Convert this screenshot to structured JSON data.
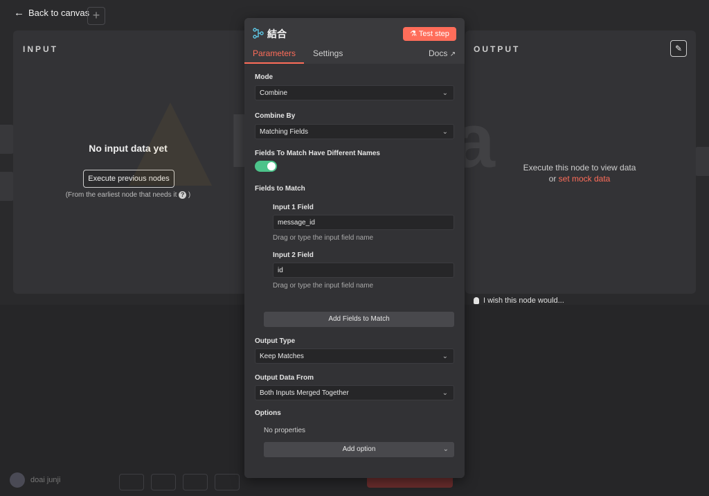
{
  "topbar": {
    "back_label": "Back to canvas",
    "add_icon": "plus-icon"
  },
  "input_panel": {
    "title": "INPUT",
    "empty_title": "No input data yet",
    "exec_button": "Execute previous nodes",
    "earliest_note": "(From the earliest node that needs it",
    "help_glyph": "?",
    "close_paren": ")"
  },
  "output_panel": {
    "title": "OUTPUT",
    "exec_msg_line1": "Execute this node to view data",
    "exec_msg_or": "or",
    "mock_link": "set mock data",
    "wish_text": "I wish this node would..."
  },
  "watermark": {
    "text": "Digicra"
  },
  "node": {
    "name": "結合",
    "test_button": "Test step",
    "tabs": [
      "Parameters",
      "Settings"
    ],
    "docs_label": "Docs",
    "colors": {
      "accent": "#ff6d5a",
      "toggle_on": "#4cc38a"
    }
  },
  "params": {
    "mode_label": "Mode",
    "mode_value": "Combine",
    "combine_by_label": "Combine By",
    "combine_by_value": "Matching Fields",
    "diff_names_label": "Fields To Match Have Different Names",
    "diff_names_enabled": true,
    "fields_to_match_label": "Fields to Match",
    "input1_label": "Input 1 Field",
    "input1_value": "message_id",
    "input1_hint": "Drag or type the input field name",
    "input2_label": "Input 2 Field",
    "input2_value": "id",
    "input2_hint": "Drag or type the input field name",
    "add_fields_button": "Add Fields to Match",
    "output_type_label": "Output Type",
    "output_type_value": "Keep Matches",
    "output_from_label": "Output Data From",
    "output_from_value": "Both Inputs Merged Together",
    "options_label": "Options",
    "no_properties": "No properties",
    "add_option_button": "Add option"
  },
  "bottom": {
    "user_name": "doai junji"
  }
}
